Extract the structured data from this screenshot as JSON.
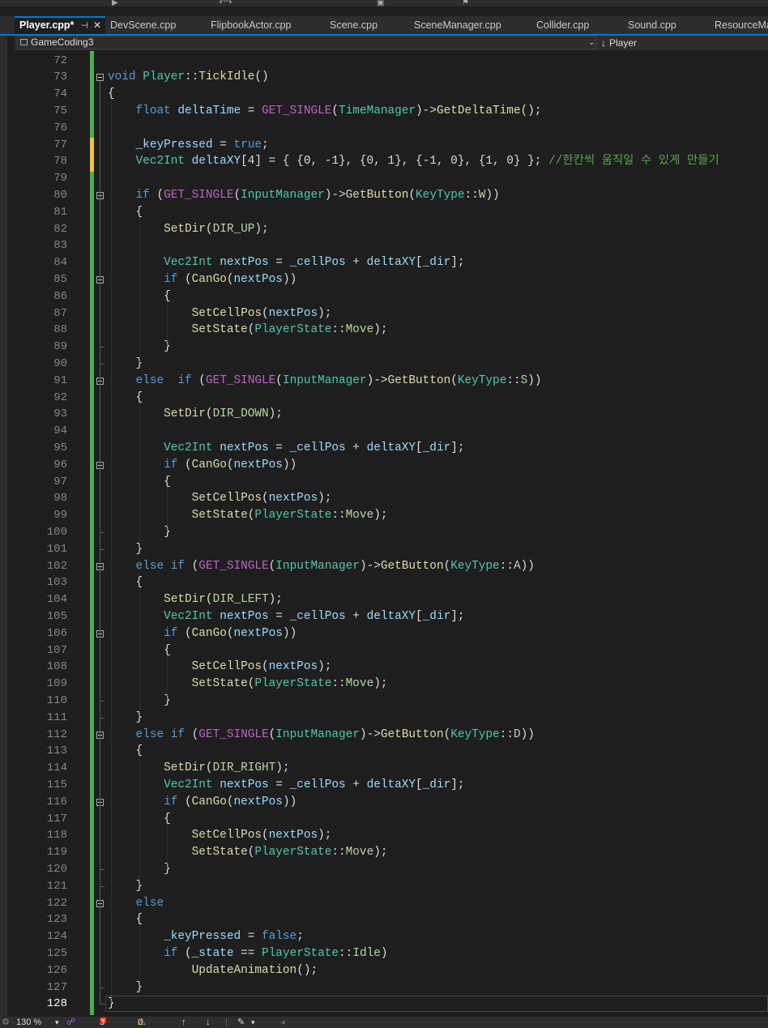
{
  "tabs": [
    {
      "label": "Player.cpp*",
      "active": true
    },
    {
      "label": "DevScene.cpp"
    },
    {
      "label": "FlipbookActor.cpp"
    },
    {
      "label": "Scene.cpp"
    },
    {
      "label": "SceneManager.cpp"
    },
    {
      "label": "Collider.cpp"
    },
    {
      "label": "Sound.cpp"
    },
    {
      "label": "ResourceManager.cpp"
    }
  ],
  "tab_pin_icon": "⊣",
  "tab_close_icon": "✕",
  "navbar": {
    "project": "GameCoding3",
    "scope": "Player",
    "dropdown_icon": "⌄",
    "scope_arrow": "↓"
  },
  "current_line": 128,
  "code_lines": [
    {
      "n": 72,
      "t": []
    },
    {
      "n": 73,
      "f": true,
      "t": [
        [
          "void",
          "kw"
        ],
        [
          " "
        ],
        [
          "Player",
          "ty"
        ],
        [
          "::"
        ],
        [
          "TickIdle",
          "fn"
        ],
        [
          "()"
        ]
      ]
    },
    {
      "n": 74,
      "t": [
        [
          "{"
        ]
      ]
    },
    {
      "n": 75,
      "t": [
        [
          "    "
        ],
        [
          "float",
          "kw"
        ],
        [
          " "
        ],
        [
          "deltaTime",
          "va"
        ],
        [
          " = "
        ],
        [
          "GET_SINGLE",
          "mc"
        ],
        [
          "("
        ],
        [
          "TimeManager",
          "ty"
        ],
        [
          ")->"
        ],
        [
          "GetDeltaTime",
          "fn"
        ],
        [
          "();"
        ]
      ]
    },
    {
      "n": 76,
      "t": []
    },
    {
      "n": 77,
      "t": [
        [
          "    "
        ],
        [
          "_keyPressed",
          "va"
        ],
        [
          " = "
        ],
        [
          "true",
          "kw"
        ],
        [
          ";"
        ]
      ]
    },
    {
      "n": 78,
      "t": [
        [
          "    "
        ],
        [
          "Vec2Int",
          "ty"
        ],
        [
          " "
        ],
        [
          "deltaXY",
          "va"
        ],
        [
          "[4] = { {0, -1}, {0, 1}, {-1, 0}, {1, 0} }; "
        ],
        [
          "//한칸씩 움직일 수 있게 만들기",
          "cm"
        ]
      ]
    },
    {
      "n": 79,
      "t": []
    },
    {
      "n": 80,
      "f": true,
      "t": [
        [
          "    "
        ],
        [
          "if",
          "kw"
        ],
        [
          " ("
        ],
        [
          "GET_SINGLE",
          "mc"
        ],
        [
          "("
        ],
        [
          "InputManager",
          "ty"
        ],
        [
          ")->"
        ],
        [
          "GetButton",
          "fn"
        ],
        [
          "("
        ],
        [
          "KeyType",
          "ty"
        ],
        [
          "::"
        ],
        [
          "W",
          "en"
        ],
        [
          "))"
        ]
      ]
    },
    {
      "n": 81,
      "t": [
        [
          "    {"
        ]
      ]
    },
    {
      "n": 82,
      "t": [
        [
          "        "
        ],
        [
          "SetDir",
          "fn"
        ],
        [
          "("
        ],
        [
          "DIR_UP",
          "en"
        ],
        [
          ");"
        ]
      ]
    },
    {
      "n": 83,
      "t": []
    },
    {
      "n": 84,
      "t": [
        [
          "        "
        ],
        [
          "Vec2Int",
          "ty"
        ],
        [
          " "
        ],
        [
          "nextPos",
          "va"
        ],
        [
          " = "
        ],
        [
          "_cellPos",
          "va"
        ],
        [
          " + "
        ],
        [
          "deltaXY",
          "va"
        ],
        [
          "["
        ],
        [
          "_dir",
          "va"
        ],
        [
          "];"
        ]
      ]
    },
    {
      "n": 85,
      "f": true,
      "t": [
        [
          "        "
        ],
        [
          "if",
          "kw"
        ],
        [
          " ("
        ],
        [
          "CanGo",
          "fn"
        ],
        [
          "("
        ],
        [
          "nextPos",
          "va"
        ],
        [
          "))"
        ]
      ]
    },
    {
      "n": 86,
      "t": [
        [
          "        {"
        ]
      ]
    },
    {
      "n": 87,
      "t": [
        [
          "            "
        ],
        [
          "SetCellPos",
          "fn"
        ],
        [
          "("
        ],
        [
          "nextPos",
          "va"
        ],
        [
          ");"
        ]
      ]
    },
    {
      "n": 88,
      "t": [
        [
          "            "
        ],
        [
          "SetState",
          "fn"
        ],
        [
          "("
        ],
        [
          "PlayerState",
          "ty"
        ],
        [
          "::"
        ],
        [
          "Move",
          "en"
        ],
        [
          ");"
        ]
      ]
    },
    {
      "n": 89,
      "t": [
        [
          "        }"
        ]
      ]
    },
    {
      "n": 90,
      "t": [
        [
          "    }"
        ]
      ]
    },
    {
      "n": 91,
      "f": true,
      "t": [
        [
          "    "
        ],
        [
          "else",
          "kw"
        ],
        [
          "  "
        ],
        [
          "if",
          "kw"
        ],
        [
          " ("
        ],
        [
          "GET_SINGLE",
          "mc"
        ],
        [
          "("
        ],
        [
          "InputManager",
          "ty"
        ],
        [
          ")->"
        ],
        [
          "GetButton",
          "fn"
        ],
        [
          "("
        ],
        [
          "KeyType",
          "ty"
        ],
        [
          "::"
        ],
        [
          "S",
          "en"
        ],
        [
          "))"
        ]
      ]
    },
    {
      "n": 92,
      "t": [
        [
          "    {"
        ]
      ]
    },
    {
      "n": 93,
      "t": [
        [
          "        "
        ],
        [
          "SetDir",
          "fn"
        ],
        [
          "("
        ],
        [
          "DIR_DOWN",
          "en"
        ],
        [
          ");"
        ]
      ]
    },
    {
      "n": 94,
      "t": []
    },
    {
      "n": 95,
      "t": [
        [
          "        "
        ],
        [
          "Vec2Int",
          "ty"
        ],
        [
          " "
        ],
        [
          "nextPos",
          "va"
        ],
        [
          " = "
        ],
        [
          "_cellPos",
          "va"
        ],
        [
          " + "
        ],
        [
          "deltaXY",
          "va"
        ],
        [
          "["
        ],
        [
          "_dir",
          "va"
        ],
        [
          "];"
        ]
      ]
    },
    {
      "n": 96,
      "f": true,
      "t": [
        [
          "        "
        ],
        [
          "if",
          "kw"
        ],
        [
          " ("
        ],
        [
          "CanGo",
          "fn"
        ],
        [
          "("
        ],
        [
          "nextPos",
          "va"
        ],
        [
          "))"
        ]
      ]
    },
    {
      "n": 97,
      "t": [
        [
          "        {"
        ]
      ]
    },
    {
      "n": 98,
      "t": [
        [
          "            "
        ],
        [
          "SetCellPos",
          "fn"
        ],
        [
          "("
        ],
        [
          "nextPos",
          "va"
        ],
        [
          ");"
        ]
      ]
    },
    {
      "n": 99,
      "t": [
        [
          "            "
        ],
        [
          "SetState",
          "fn"
        ],
        [
          "("
        ],
        [
          "PlayerState",
          "ty"
        ],
        [
          "::"
        ],
        [
          "Move",
          "en"
        ],
        [
          ");"
        ]
      ]
    },
    {
      "n": 100,
      "t": [
        [
          "        }"
        ]
      ]
    },
    {
      "n": 101,
      "t": [
        [
          "    }"
        ]
      ]
    },
    {
      "n": 102,
      "f": true,
      "t": [
        [
          "    "
        ],
        [
          "else",
          "kw"
        ],
        [
          " "
        ],
        [
          "if",
          "kw"
        ],
        [
          " ("
        ],
        [
          "GET_SINGLE",
          "mc"
        ],
        [
          "("
        ],
        [
          "InputManager",
          "ty"
        ],
        [
          ")->"
        ],
        [
          "GetButton",
          "fn"
        ],
        [
          "("
        ],
        [
          "KeyType",
          "ty"
        ],
        [
          "::"
        ],
        [
          "A",
          "en"
        ],
        [
          "))"
        ]
      ]
    },
    {
      "n": 103,
      "t": [
        [
          "    {"
        ]
      ]
    },
    {
      "n": 104,
      "t": [
        [
          "        "
        ],
        [
          "SetDir",
          "fn"
        ],
        [
          "("
        ],
        [
          "DIR_LEFT",
          "en"
        ],
        [
          ");"
        ]
      ]
    },
    {
      "n": 105,
      "t": [
        [
          "        "
        ],
        [
          "Vec2Int",
          "ty"
        ],
        [
          " "
        ],
        [
          "nextPos",
          "va"
        ],
        [
          " = "
        ],
        [
          "_cellPos",
          "va"
        ],
        [
          " + "
        ],
        [
          "deltaXY",
          "va"
        ],
        [
          "["
        ],
        [
          "_dir",
          "va"
        ],
        [
          "];"
        ]
      ]
    },
    {
      "n": 106,
      "f": true,
      "t": [
        [
          "        "
        ],
        [
          "if",
          "kw"
        ],
        [
          " ("
        ],
        [
          "CanGo",
          "fn"
        ],
        [
          "("
        ],
        [
          "nextPos",
          "va"
        ],
        [
          "))"
        ]
      ]
    },
    {
      "n": 107,
      "t": [
        [
          "        {"
        ]
      ]
    },
    {
      "n": 108,
      "t": [
        [
          "            "
        ],
        [
          "SetCellPos",
          "fn"
        ],
        [
          "("
        ],
        [
          "nextPos",
          "va"
        ],
        [
          ");"
        ]
      ]
    },
    {
      "n": 109,
      "t": [
        [
          "            "
        ],
        [
          "SetState",
          "fn"
        ],
        [
          "("
        ],
        [
          "PlayerState",
          "ty"
        ],
        [
          "::"
        ],
        [
          "Move",
          "en"
        ],
        [
          ");"
        ]
      ]
    },
    {
      "n": 110,
      "t": [
        [
          "        }"
        ]
      ]
    },
    {
      "n": 111,
      "t": [
        [
          "    }"
        ]
      ]
    },
    {
      "n": 112,
      "f": true,
      "t": [
        [
          "    "
        ],
        [
          "else",
          "kw"
        ],
        [
          " "
        ],
        [
          "if",
          "kw"
        ],
        [
          " ("
        ],
        [
          "GET_SINGLE",
          "mc"
        ],
        [
          "("
        ],
        [
          "InputManager",
          "ty"
        ],
        [
          ")->"
        ],
        [
          "GetButton",
          "fn"
        ],
        [
          "("
        ],
        [
          "KeyType",
          "ty"
        ],
        [
          "::"
        ],
        [
          "D",
          "en"
        ],
        [
          "))"
        ]
      ]
    },
    {
      "n": 113,
      "t": [
        [
          "    {"
        ]
      ]
    },
    {
      "n": 114,
      "t": [
        [
          "        "
        ],
        [
          "SetDir",
          "fn"
        ],
        [
          "("
        ],
        [
          "DIR_RIGHT",
          "en"
        ],
        [
          ");"
        ]
      ]
    },
    {
      "n": 115,
      "t": [
        [
          "        "
        ],
        [
          "Vec2Int",
          "ty"
        ],
        [
          " "
        ],
        [
          "nextPos",
          "va"
        ],
        [
          " = "
        ],
        [
          "_cellPos",
          "va"
        ],
        [
          " + "
        ],
        [
          "deltaXY",
          "va"
        ],
        [
          "["
        ],
        [
          "_dir",
          "va"
        ],
        [
          "];"
        ]
      ]
    },
    {
      "n": 116,
      "f": true,
      "t": [
        [
          "        "
        ],
        [
          "if",
          "kw"
        ],
        [
          " ("
        ],
        [
          "CanGo",
          "fn"
        ],
        [
          "("
        ],
        [
          "nextPos",
          "va"
        ],
        [
          "))"
        ]
      ]
    },
    {
      "n": 117,
      "t": [
        [
          "        {"
        ]
      ]
    },
    {
      "n": 118,
      "t": [
        [
          "            "
        ],
        [
          "SetCellPos",
          "fn"
        ],
        [
          "("
        ],
        [
          "nextPos",
          "va"
        ],
        [
          ");"
        ]
      ]
    },
    {
      "n": 119,
      "t": [
        [
          "            "
        ],
        [
          "SetState",
          "fn"
        ],
        [
          "("
        ],
        [
          "PlayerState",
          "ty"
        ],
        [
          "::"
        ],
        [
          "Move",
          "en"
        ],
        [
          ");"
        ]
      ]
    },
    {
      "n": 120,
      "t": [
        [
          "        }"
        ]
      ]
    },
    {
      "n": 121,
      "t": [
        [
          "    }"
        ]
      ]
    },
    {
      "n": 122,
      "f": true,
      "t": [
        [
          "    "
        ],
        [
          "else",
          "kw"
        ]
      ]
    },
    {
      "n": 123,
      "t": [
        [
          "    {"
        ]
      ]
    },
    {
      "n": 124,
      "t": [
        [
          "        "
        ],
        [
          "_keyPressed",
          "va"
        ],
        [
          " = "
        ],
        [
          "false",
          "kw"
        ],
        [
          ";"
        ]
      ]
    },
    {
      "n": 125,
      "t": [
        [
          "        "
        ],
        [
          "if",
          "kw"
        ],
        [
          " ("
        ],
        [
          "_state",
          "va"
        ],
        [
          " == "
        ],
        [
          "PlayerState",
          "ty"
        ],
        [
          "::"
        ],
        [
          "Idle",
          "en"
        ],
        [
          ")"
        ]
      ]
    },
    {
      "n": 126,
      "t": [
        [
          "            "
        ],
        [
          "UpdateAnimation",
          "fn"
        ],
        [
          "();"
        ]
      ]
    },
    {
      "n": 127,
      "t": [
        [
          "    }"
        ]
      ]
    },
    {
      "n": 128,
      "t": [
        [
          "}"
        ]
      ]
    }
  ],
  "status": {
    "zoom": "130 %",
    "errors": "3",
    "warnings": "0",
    "up_icon": "↑",
    "down_icon": "↓",
    "brush_icon": "✎"
  },
  "colors": {
    "accent": "#007acc",
    "change_saved": "#4cae4f",
    "change_unsaved": "#efc13c",
    "background": "#1e1e1e"
  }
}
